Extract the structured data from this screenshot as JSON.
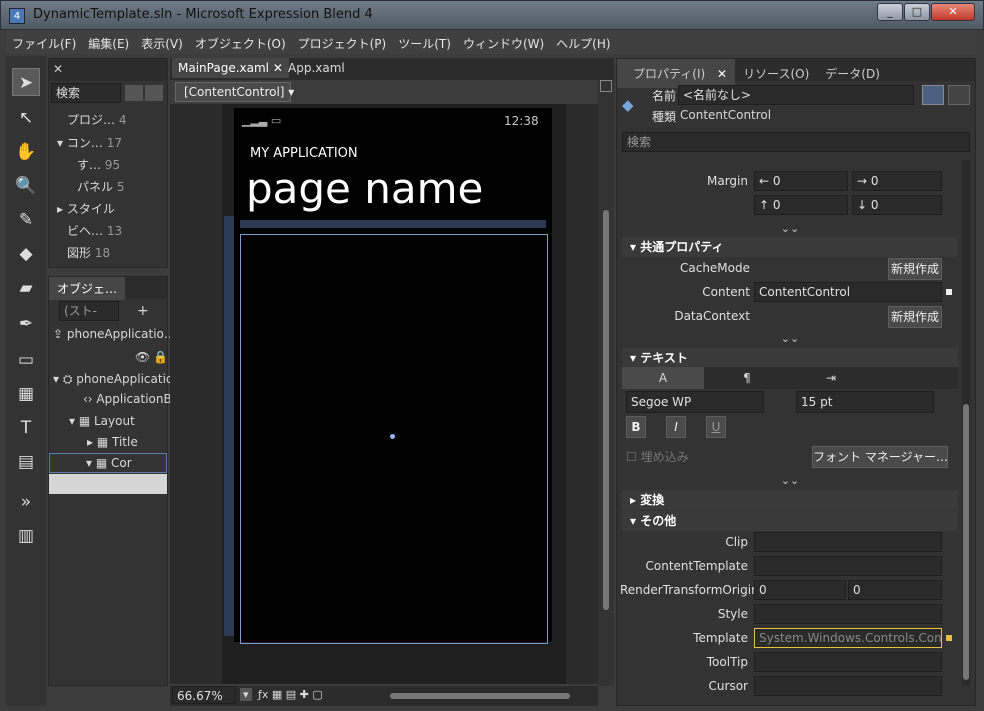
{
  "window": {
    "title": "DynamicTemplate.sln - Microsoft Expression Blend 4",
    "icon_label": "4",
    "buttons": [
      "_",
      "□",
      "✕"
    ]
  },
  "menu": [
    "ファイル(F)",
    "編集(E)",
    "表示(V)",
    "オブジェクト(O)",
    "プロジェクト(P)",
    "ツール(T)",
    "ウィンドウ(W)",
    "ヘルプ(H)"
  ],
  "assets": {
    "search_placeholder": "検索",
    "items": [
      {
        "label": "プロジ…",
        "count": "4"
      },
      {
        "label": "コン…",
        "count": "17"
      },
      {
        "label": "す…",
        "count": "95"
      },
      {
        "label": "パネル",
        "count": "5"
      },
      {
        "label": "スタイル",
        "count": ""
      },
      {
        "label": "ビヘ…",
        "count": "13"
      },
      {
        "label": "図形",
        "count": "18"
      }
    ]
  },
  "objects": {
    "title": "オブジェ…",
    "storyboard_placeholder": "(スト-",
    "tree": [
      {
        "label": "phoneApplicatio…"
      },
      {
        "label": "phoneApplication"
      },
      {
        "label": "ApplicationBa"
      },
      {
        "label": "Layout"
      },
      {
        "label": "Title"
      },
      {
        "label": "Cor"
      }
    ]
  },
  "doc_tabs": [
    {
      "label": "MainPage.xaml",
      "active": true
    },
    {
      "label": "App.xaml",
      "active": false
    }
  ],
  "breadcrumb": "[ContentControl] ▾",
  "phone": {
    "time": "12:38",
    "app_title": "MY APPLICATION",
    "page_name": "page name"
  },
  "zoom": "66.67%",
  "properties": {
    "tabs": [
      "プロパティ(I)",
      "リソース(O)",
      "データ(D)"
    ],
    "name_label": "名前",
    "name_value": "<名前なし>",
    "type_label": "種類",
    "type_value": "ContentControl",
    "search_placeholder": "検索",
    "margin_label": "Margin",
    "margin": [
      "0",
      "0",
      "0",
      "0"
    ],
    "common_section": "共通プロパティ",
    "cachemode_label": "CacheMode",
    "new_button": "新規作成",
    "content_label": "Content",
    "content_value": "ContentControl",
    "datacontext_label": "DataContext",
    "text_section": "テキスト",
    "font_family": "Segoe WP",
    "font_size": "15 pt",
    "bold": "B",
    "italic": "I",
    "underline": "U",
    "embed_label": "埋め込み",
    "font_manager": "フォント マネージャー…",
    "transform_section": "変換",
    "misc_section": "その他",
    "misc_rows": [
      {
        "label": "Clip",
        "value": ""
      },
      {
        "label": "ContentTemplate",
        "value": ""
      },
      {
        "label": "RenderTransformOrigin",
        "value": ""
      },
      {
        "label": "Style",
        "value": ""
      },
      {
        "label": "Template",
        "value": "System.Windows.Controls.Con…"
      },
      {
        "label": "ToolTip",
        "value": ""
      },
      {
        "label": "Cursor",
        "value": ""
      }
    ],
    "rto": [
      "0",
      "0"
    ]
  },
  "colors": {
    "accent": "#e8c040",
    "selection": "#5c7cb0"
  }
}
